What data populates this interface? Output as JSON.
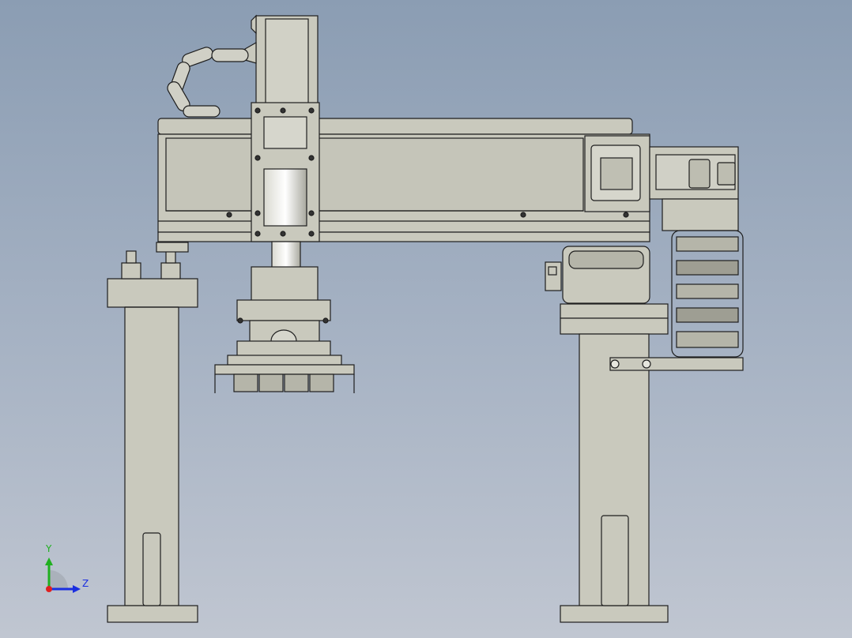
{
  "triad": {
    "y_label": "Y",
    "z_label": "Z",
    "y_color": "#20b020",
    "z_color": "#1a2ee0",
    "x_color": "#e02020"
  },
  "colors": {
    "background_top": "#8b9db3",
    "background_bottom": "#c0c6d1",
    "part_fill": "#c9c9bd",
    "part_fill_dark": "#b5b5a9",
    "edge": "#1e1e1e"
  }
}
